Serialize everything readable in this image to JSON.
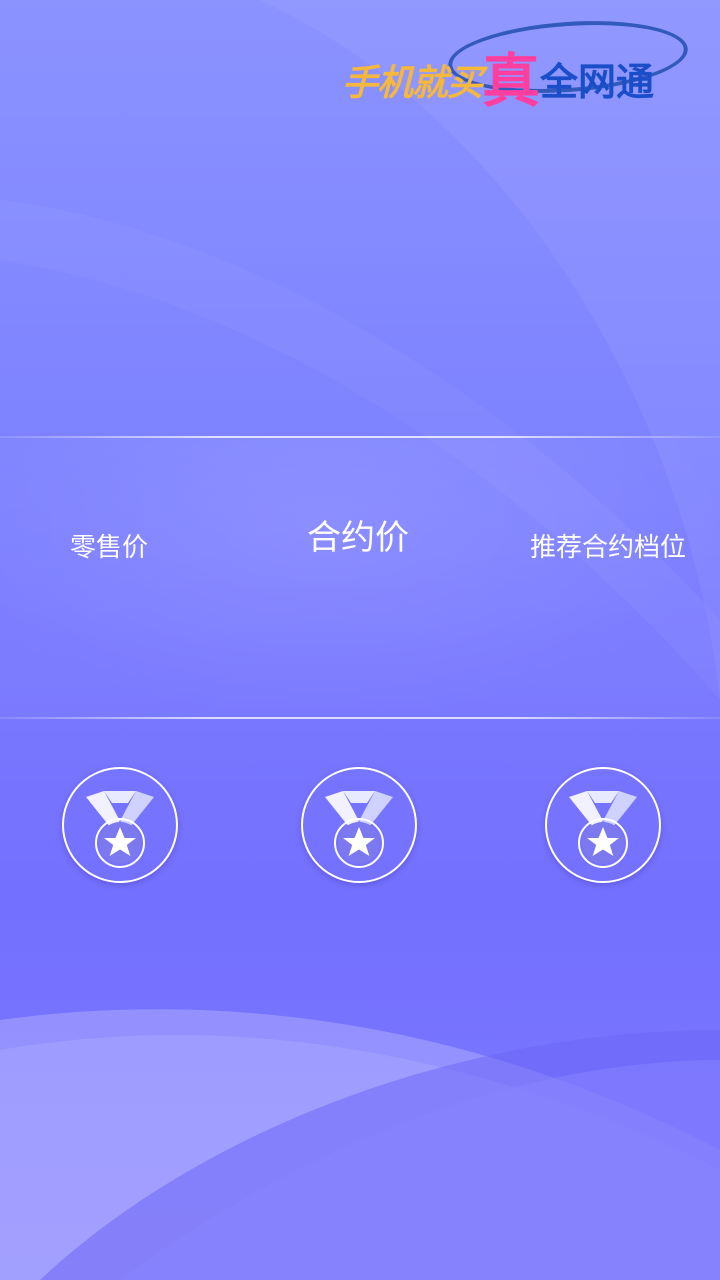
{
  "logo": {
    "part1": "手机就买",
    "part2": "真",
    "part3": "全网通"
  },
  "price_labels": {
    "retail": "零售价",
    "contract": "合约价",
    "recommended_tier": "推荐合约档位"
  },
  "medals": [
    {
      "icon": "medal-star-icon"
    },
    {
      "icon": "medal-star-icon"
    },
    {
      "icon": "medal-star-icon"
    }
  ],
  "colors": {
    "background": "#7d7aff",
    "text": "#ffffff",
    "logo_orange": "#f6b73d",
    "logo_pink": "#ff3fa0",
    "logo_blue": "#1a4ec8"
  }
}
